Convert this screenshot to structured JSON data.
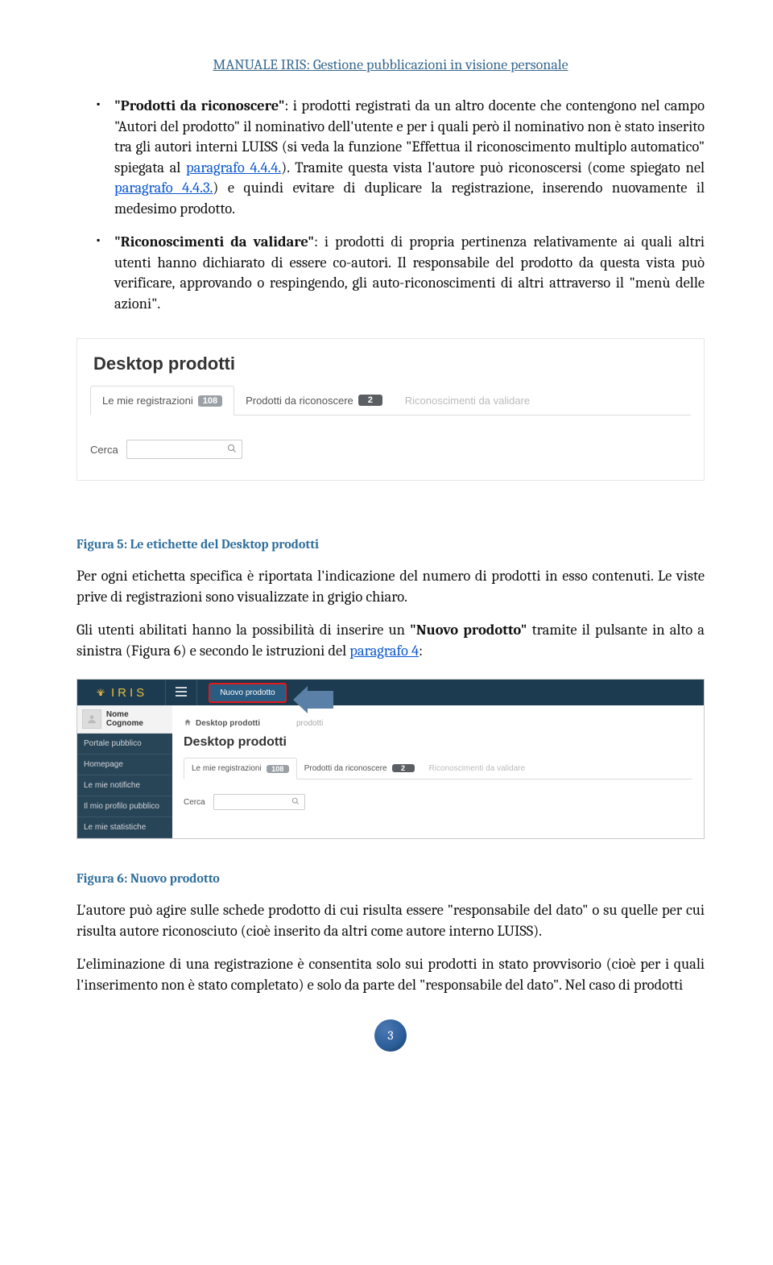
{
  "header": {
    "title": "MANUALE IRIS: Gestione pubblicazioni in visione personale"
  },
  "bullets": {
    "b1": {
      "lead": "\"Prodotti da riconoscere\"",
      "t1": ": i prodotti registrati da un altro docente che contengono nel campo \"Autori del prodotto\" il nominativo dell'utente e per i quali però il nominativo non è stato inserito tra gli autori interni LUISS (si veda la funzione \"Effettua il riconoscimento multiplo automatico\" spiegata al ",
      "link1": "paragrafo 4.4.4.",
      "t2": "). Tramite questa vista l'autore può riconoscersi (come spiegato nel ",
      "link2": "paragrafo 4.4.3.",
      "t3": ") e quindi evitare di duplicare la registrazione, inserendo nuovamente il medesimo prodotto."
    },
    "b2": {
      "lead": "\"Riconoscimenti da validare\"",
      "t1": ": i prodotti di propria pertinenza relativamente ai quali altri utenti hanno dichiarato di essere co-autori. Il responsabile del prodotto da questa vista può verificare, approvando o respingendo, gli auto-riconoscimenti di altri attraverso il \"menù delle azioni\"."
    }
  },
  "shot1": {
    "title": "Desktop prodotti",
    "tab1": "Le mie registrazioni",
    "badge1": "108",
    "tab2": "Prodotti da riconoscere",
    "badge2": "2",
    "tab3": "Riconoscimenti da validare",
    "search_label": "Cerca"
  },
  "fig5": "Figura 5: Le etichette del Desktop prodotti",
  "p1": "Per ogni etichetta specifica è riportata l'indicazione del numero di prodotti in esso contenuti. Le viste prive di registrazioni sono visualizzate in grigio chiaro.",
  "p2": {
    "t1": "Gli utenti abilitati hanno la possibilità di inserire un ",
    "b1": "\"Nuovo prodotto\"",
    "t2": " tramite il pulsante in alto a sinistra (Figura 6) e secondo le istruzioni del ",
    "link": "paragrafo 4",
    "t3": ":"
  },
  "shot2": {
    "logo": "IRIS",
    "btn_new": "Nuovo prodotto",
    "user": "Nome Cognome",
    "nav": {
      "n1": "Portale pubblico",
      "n2": "Homepage",
      "n3": "Le mie notifiche",
      "n4": "Il mio profilo pubblico",
      "n5": "Le mie statistiche"
    },
    "crumb1": "Desktop prodotti",
    "crumb2": "prodotti",
    "title": "Desktop prodotti",
    "tab1": "Le mie registrazioni",
    "badge1": "108",
    "tab2": "Prodotti da riconoscere",
    "badge2": "2",
    "tab3": "Riconoscimenti da validare",
    "search_label": "Cerca"
  },
  "fig6": "Figura 6: Nuovo prodotto",
  "p3": "L'autore può agire sulle schede prodotto di cui risulta essere \"responsabile del dato\" o su quelle per cui risulta autore riconosciuto (cioè inserito da altri come autore interno LUISS).",
  "p4": "L'eliminazione di una registrazione è consentita solo sui prodotti in stato provvisorio (cioè per i quali l'inserimento non è stato completato) e solo da parte del \"responsabile del dato\". Nel caso di prodotti",
  "pagenum": "3"
}
